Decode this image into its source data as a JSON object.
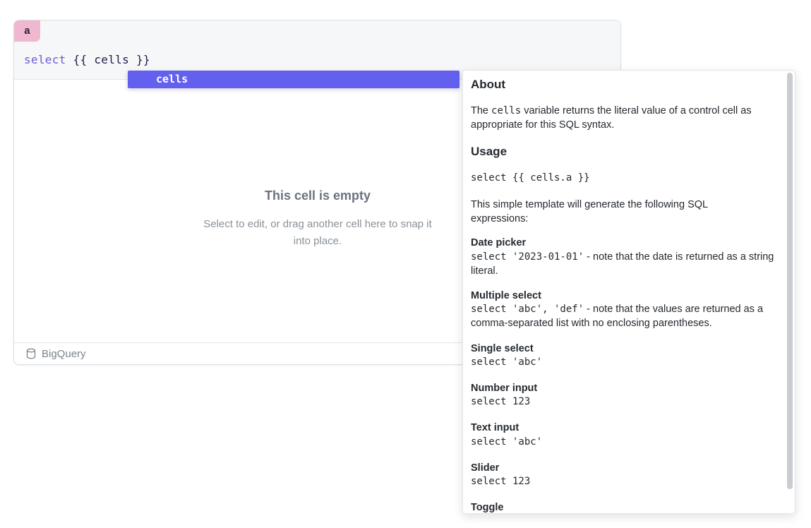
{
  "cell": {
    "tag": "a",
    "code": {
      "keyword": "select",
      "template": "{{ cells }}"
    },
    "empty_title": "This cell is empty",
    "empty_desc": "Select to edit, or drag another cell here to snap it into place.",
    "footer": {
      "source_label": "BigQuery",
      "source_icon": "database-icon"
    }
  },
  "autocomplete": {
    "items": [
      {
        "label": "cells",
        "selected": true
      }
    ]
  },
  "docs": {
    "about_heading": "About",
    "about_text_pre": "The ",
    "about_text_code": "cells",
    "about_text_post": " variable returns the literal value of a control cell as appropriate for this SQL syntax.",
    "usage_heading": "Usage",
    "usage_code": "select {{ cells.a }}",
    "usage_desc": "This simple template will generate the following SQL expressions:",
    "entries": [
      {
        "title": "Date picker",
        "code": "select '2023-01-01'",
        "note": " - note that the date is returned as a string literal."
      },
      {
        "title": "Multiple select",
        "code": "select 'abc', 'def'",
        "note": " - note that the values are returned as a comma-separated list with no enclosing parentheses."
      },
      {
        "title": "Single select",
        "code": "select 'abc'",
        "note": ""
      },
      {
        "title": "Number input",
        "code": "select 123",
        "note": ""
      },
      {
        "title": "Text input",
        "code": "select 'abc'",
        "note": ""
      },
      {
        "title": "Slider",
        "code": "select 123",
        "note": ""
      },
      {
        "title": "Toggle",
        "code": "",
        "note": ""
      }
    ]
  },
  "colors": {
    "accent": "#6360ef",
    "tag": "#f0b8d0",
    "keyword": "#6b5bd6"
  }
}
